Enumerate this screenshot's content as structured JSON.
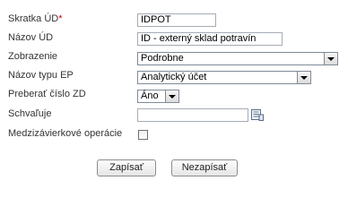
{
  "form": {
    "short_code": {
      "label": "Skratka ÚD",
      "required_mark": "*",
      "value": "IDPOT"
    },
    "name": {
      "label": "Názov ÚD",
      "value": "ID - externý sklad potravín"
    },
    "display": {
      "label": "Zobrazenie",
      "value": "Podrobne"
    },
    "ep_type": {
      "label": "Názov typu EP",
      "value": "Analytický účet"
    },
    "take_zd": {
      "label": "Preberať číslo ZD",
      "value": "Áno"
    },
    "approver": {
      "label": "Schvaľuje",
      "value": "",
      "icon": "lookup-list-icon"
    },
    "intercompany": {
      "label": "Medzizávierkové operácie",
      "checked": false
    }
  },
  "buttons": {
    "save": "Zapísať",
    "cancel": "Nezapísať"
  }
}
